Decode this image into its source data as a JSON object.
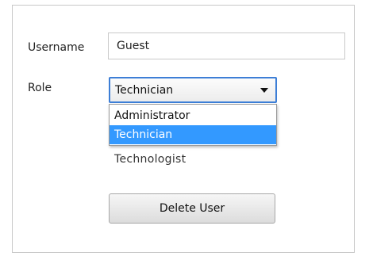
{
  "form": {
    "username_label": "Username",
    "username_value": "Guest",
    "role_label": "Role",
    "role_selected": "Technician",
    "role_options": [
      "Administrator",
      "Technician",
      "Technologist"
    ],
    "delete_button_label": "Delete User"
  },
  "icons": {
    "dropdown_arrow": "chevron-down-icon"
  },
  "colors": {
    "selection_highlight": "#3399ff",
    "focus_border": "#3d7ed6"
  }
}
